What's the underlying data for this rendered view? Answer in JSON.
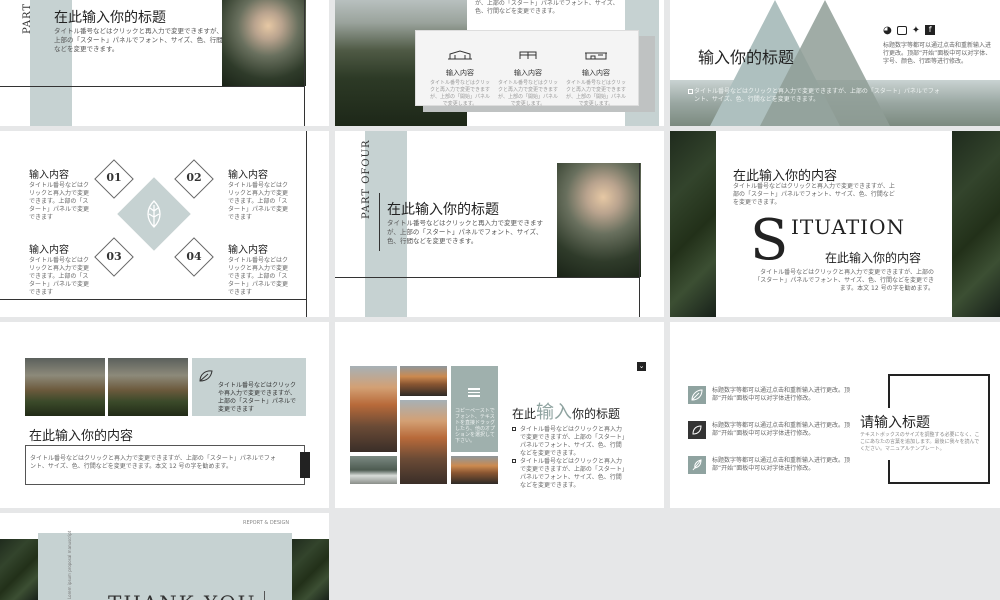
{
  "colors": {
    "sage": "#c6d2d2",
    "background": "#e6e7e8",
    "dark": "#222222",
    "white": "#ffffff"
  },
  "slide1": {
    "part_label": "PART",
    "title": "在此输入你的标题",
    "body": "タイトル番号などはクリックと再入力で変更できますが、上部の「スタート」パネルでフォント、サイズ、色、行間などを変更できます。"
  },
  "slide2": {
    "top_text": "す。",
    "top_text2": "が、上部の「スタート」パネルでフォント、サイズ、色、行間などを変更できます。",
    "items": [
      {
        "label": "输入内容",
        "body": "タイトル番号などはクリックと再入力で変更できますが、上部の「開始」パネルで変更します。"
      },
      {
        "label": "输入内容",
        "body": "タイトル番号などはクリックと再入力で変更できますが、上部の「開始」パネルで変更します。"
      },
      {
        "label": "输入内容",
        "body": "タイトル番号などはクリックと再入力で変更できますが、上部の「開始」パネルで変更します。"
      }
    ]
  },
  "slide3": {
    "title": "输入你的标题",
    "body": "标题数字等都可以通过点击和重新输入进行更改。顶部“开始”面板中可以对字体、字号、颜色、行距等进行修改。",
    "footer": "タイトル番号などはクリックと再入力で変更できますが、上部の「スタート」パネルでフォント、サイズ、色、行間などを変更できます。",
    "social_icons": [
      "weibo-icon",
      "camera-icon",
      "twitter-icon",
      "facebook-icon"
    ]
  },
  "slide4": {
    "items": [
      {
        "num": "01",
        "label": "输入内容",
        "body": "タイトル番号などはクリックと再入力で変更できます。上部の「スタート」パネルで変更できます"
      },
      {
        "num": "02",
        "label": "输入内容",
        "body": "タイトル番号などはクリックと再入力で変更できます。上部の「スタート」パネルで変更できます"
      },
      {
        "num": "03",
        "label": "输入内容",
        "body": "タイトル番号などはクリックと再入力で変更できます。上部の「スタート」パネルで変更できます"
      },
      {
        "num": "04",
        "label": "输入内容",
        "body": "タイトル番号などはクリックと再入力で変更できます。上部の「スタート」パネルで変更できます"
      }
    ]
  },
  "slide5": {
    "part_label": "PART OFOUR",
    "title": "在此输入你的标题",
    "body": "タイトル番号などはクリックと再入力で変更できますが、上部の「スタート」パネルでフォント、サイズ、色、行間などを変更できます。"
  },
  "slide6": {
    "heading": "在此输入你的内容",
    "heading_body": "タイトル番号などはクリックと再入力で変更できますが、上部の「スタート」パネルでフォント、サイズ、色、行間などを変更できます。",
    "big_letter": "S",
    "big_word": "ITUATION",
    "sub_heading": "在此输入你的内容",
    "sub_body": "タイトル番号などはクリックと再入力で変更できますが、上部の「スタート」パネルでフォント、サイズ、色、行間などを変更できます。本文 12 号の字を勧めます。"
  },
  "slide7": {
    "side_text": "タイトル番号などはクリックや再入力で変更できますが、上部の「スタート」パネルで変更できます",
    "heading": "在此输入你的内容",
    "body": "タイトル番号などはクリックと再入力で変更できますが、上部の「スタート」パネルでフォント、サイズ、色、行間などを変更できます。本文 12 号の字を勧めます。"
  },
  "slide8": {
    "sage_text": "コピーペーストでフォント、テキストを直接ドラッグしたら、他のオプションを選択して下さい。",
    "title_pre": "在此",
    "title_big": "输入",
    "title_post": "你的标题",
    "bullets": [
      "タイトル番号などはクリックと再入力で変更できますが、上部の「スタート」パネルでフォント、サイズ、色、行間などを変更できます。",
      "タイトル番号などはクリックと再入力で変更できますが、上部の「スタート」パネルでフォント、サイズ、色、行間などを変更できます。"
    ]
  },
  "slide9": {
    "items": [
      "标题数字等都可以通过点击和重新输入进行更改。顶部“开始”面板中可以对字体进行修改。",
      "标题数字等都可以通过点击和重新输入进行更改。顶部“开始”面板中可以对字体进行修改。",
      "标题数字等都可以通过点击和重新输入进行更改。顶部“开始”面板中可以对字体进行修改。"
    ],
    "title": "请输入标题",
    "body": "テキストボックスのサイズを調整する必要になく、ここにあなたの言葉を追加します。最後に我々を読んでください。マニュアルテンプレート。"
  },
  "slide10": {
    "tag": "REPORT & DESIGN",
    "side_text": "Lorem ipsum proposal manuscript",
    "title": "THANK YOU"
  }
}
